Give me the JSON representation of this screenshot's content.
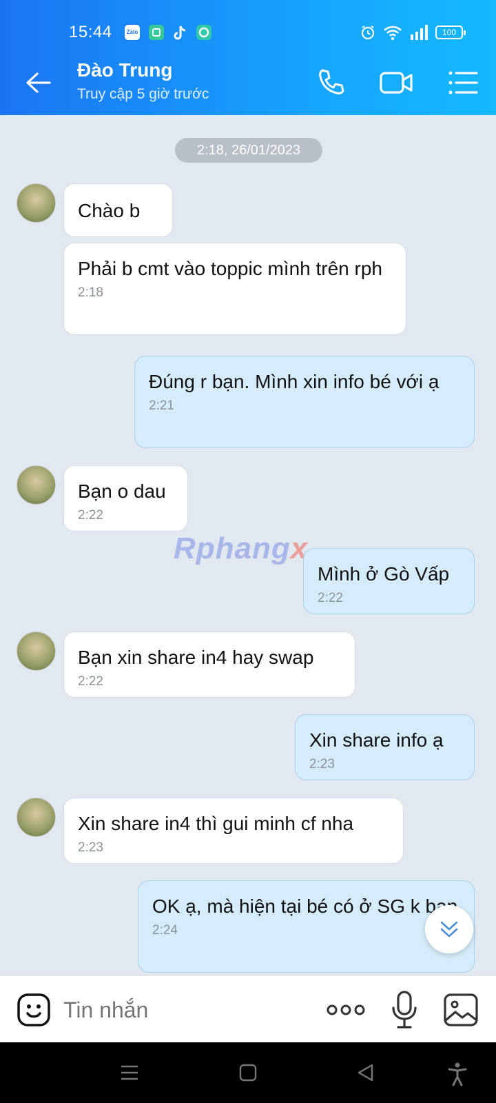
{
  "status_bar": {
    "time": "15:44",
    "battery": "100",
    "zalo_label": "Zalo"
  },
  "header": {
    "name": "Đào Trung",
    "last_seen": "Truy cập 5 giờ trước"
  },
  "chat": {
    "date": "2:18, 26/01/2023",
    "messages": [
      {
        "from": "them",
        "text": "Chào b",
        "time": ""
      },
      {
        "from": "them",
        "text": "Phải b cmt vào toppic mình trên rph",
        "time": "2:18"
      },
      {
        "from": "me",
        "text": "Đúng r bạn. Mình xin info bé với ạ",
        "time": "2:21"
      },
      {
        "from": "them",
        "text": "Bạn o dau",
        "time": "2:22"
      },
      {
        "from": "me",
        "text": "Mình ở Gò Vấp",
        "time": "2:22"
      },
      {
        "from": "them",
        "text": "Bạn xin share in4 hay swap",
        "time": "2:22"
      },
      {
        "from": "me",
        "text": "Xin share info ạ",
        "time": "2:23"
      },
      {
        "from": "them",
        "text": "Xin share in4 thì gui minh cf nha",
        "time": "2:23"
      },
      {
        "from": "me",
        "text": "OK ạ, mà hiện tại bé có ở SG k bạn",
        "time": "2:24"
      }
    ],
    "watermark": {
      "main": "Rphang",
      "x": "x"
    }
  },
  "input_bar": {
    "placeholder": "Tin nhắn"
  },
  "colors": {
    "header_start": "#1a74f2",
    "header_end": "#14b9ff",
    "outgoing_bubble": "#d4ecfb",
    "incoming_bubble": "#ffffff"
  }
}
